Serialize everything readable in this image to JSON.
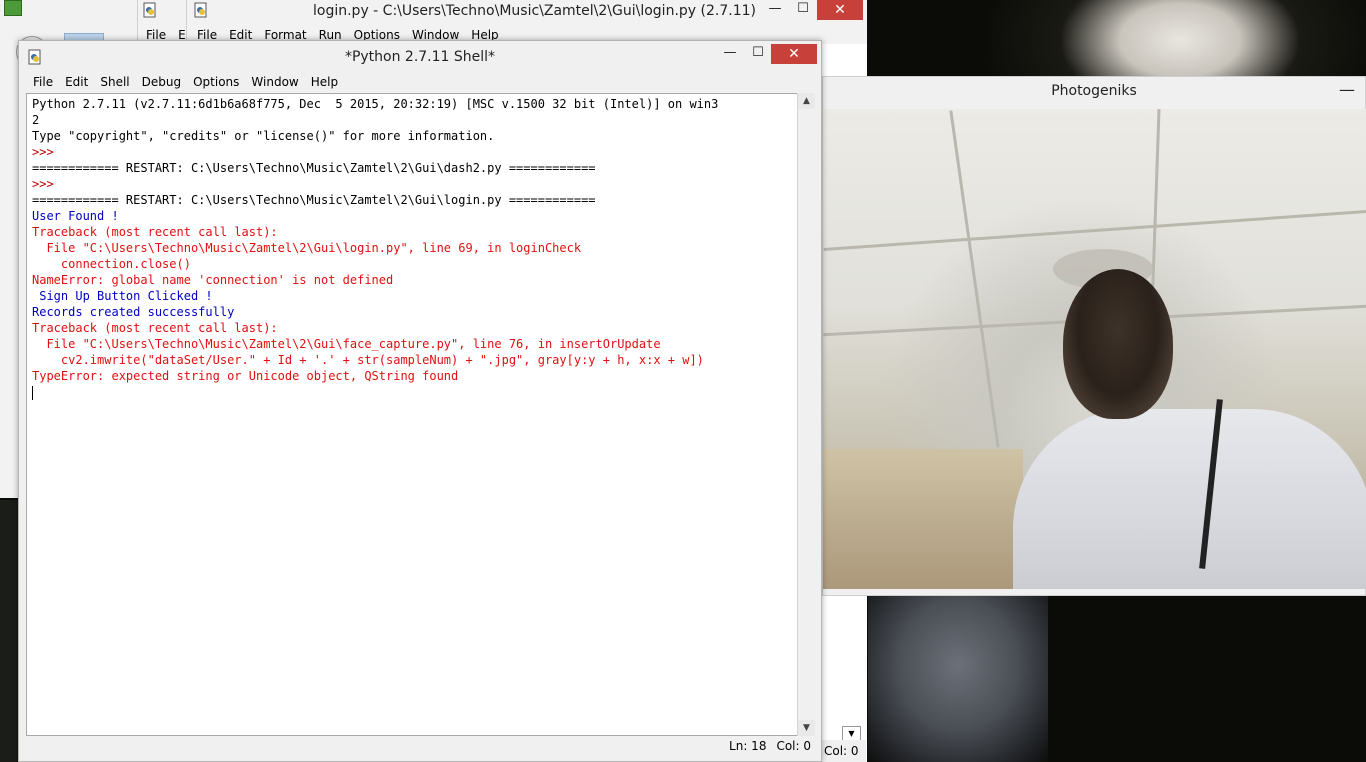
{
  "login_window": {
    "title": "login.py - C:\\Users\\Techno\\Music\\Zamtel\\2\\Gui\\login.py (2.7.11)",
    "menu": [
      "File",
      "Edit",
      "Format",
      "Run",
      "Options",
      "Window",
      "Help"
    ],
    "status_col": "Col: 0"
  },
  "back_editor": {
    "menu": [
      "File",
      "E"
    ]
  },
  "photogeniks": {
    "title": "Photogeniks",
    "minimize": "—"
  },
  "shell": {
    "title": "*Python 2.7.11 Shell*",
    "menu": [
      "File",
      "Edit",
      "Shell",
      "Debug",
      "Options",
      "Window",
      "Help"
    ],
    "lines": [
      {
        "cls": "c-norm",
        "text": "Python 2.7.11 (v2.7.11:6d1b6a68f775, Dec  5 2015, 20:32:19) [MSC v.1500 32 bit (Intel)] on win3"
      },
      {
        "cls": "c-norm",
        "text": "2"
      },
      {
        "cls": "c-norm",
        "text": "Type \"copyright\", \"credits\" or \"license()\" for more information."
      },
      {
        "cls": "c-prompt",
        "text": ">>> "
      },
      {
        "cls": "c-norm",
        "text": "============ RESTART: C:\\Users\\Techno\\Music\\Zamtel\\2\\Gui\\dash2.py ============"
      },
      {
        "cls": "c-prompt",
        "text": ">>> "
      },
      {
        "cls": "c-norm",
        "text": "============ RESTART: C:\\Users\\Techno\\Music\\Zamtel\\2\\Gui\\login.py ============"
      },
      {
        "cls": "c-out",
        "text": "User Found !"
      },
      {
        "cls": "c-err",
        "text": "Traceback (most recent call last):"
      },
      {
        "cls": "c-err",
        "text": "  File \"C:\\Users\\Techno\\Music\\Zamtel\\2\\Gui\\login.py\", line 69, in loginCheck"
      },
      {
        "cls": "c-err",
        "text": "    connection.close()"
      },
      {
        "cls": "c-err",
        "text": "NameError: global name 'connection' is not defined"
      },
      {
        "cls": "c-out",
        "text": " Sign Up Button Clicked !"
      },
      {
        "cls": "c-out",
        "text": "Records created successfully"
      },
      {
        "cls": "c-err",
        "text": "Traceback (most recent call last):"
      },
      {
        "cls": "c-err",
        "text": "  File \"C:\\Users\\Techno\\Music\\Zamtel\\2\\Gui\\face_capture.py\", line 76, in insertOrUpdate"
      },
      {
        "cls": "c-err",
        "text": "    cv2.imwrite(\"dataSet/User.\" + Id + '.' + str(sampleNum) + \".jpg\", gray[y:y + h, x:x + w])"
      },
      {
        "cls": "c-err",
        "text": "TypeError: expected string or Unicode object, QString found"
      }
    ],
    "status_ln": "Ln: 18",
    "status_col": "Col: 0",
    "minimize": "—",
    "maximize": "☐",
    "close": "✕"
  },
  "colors": {
    "prompt": "#b80000",
    "stdout": "#0000c0",
    "stderr": "#e01010",
    "close": "#c7413a"
  }
}
